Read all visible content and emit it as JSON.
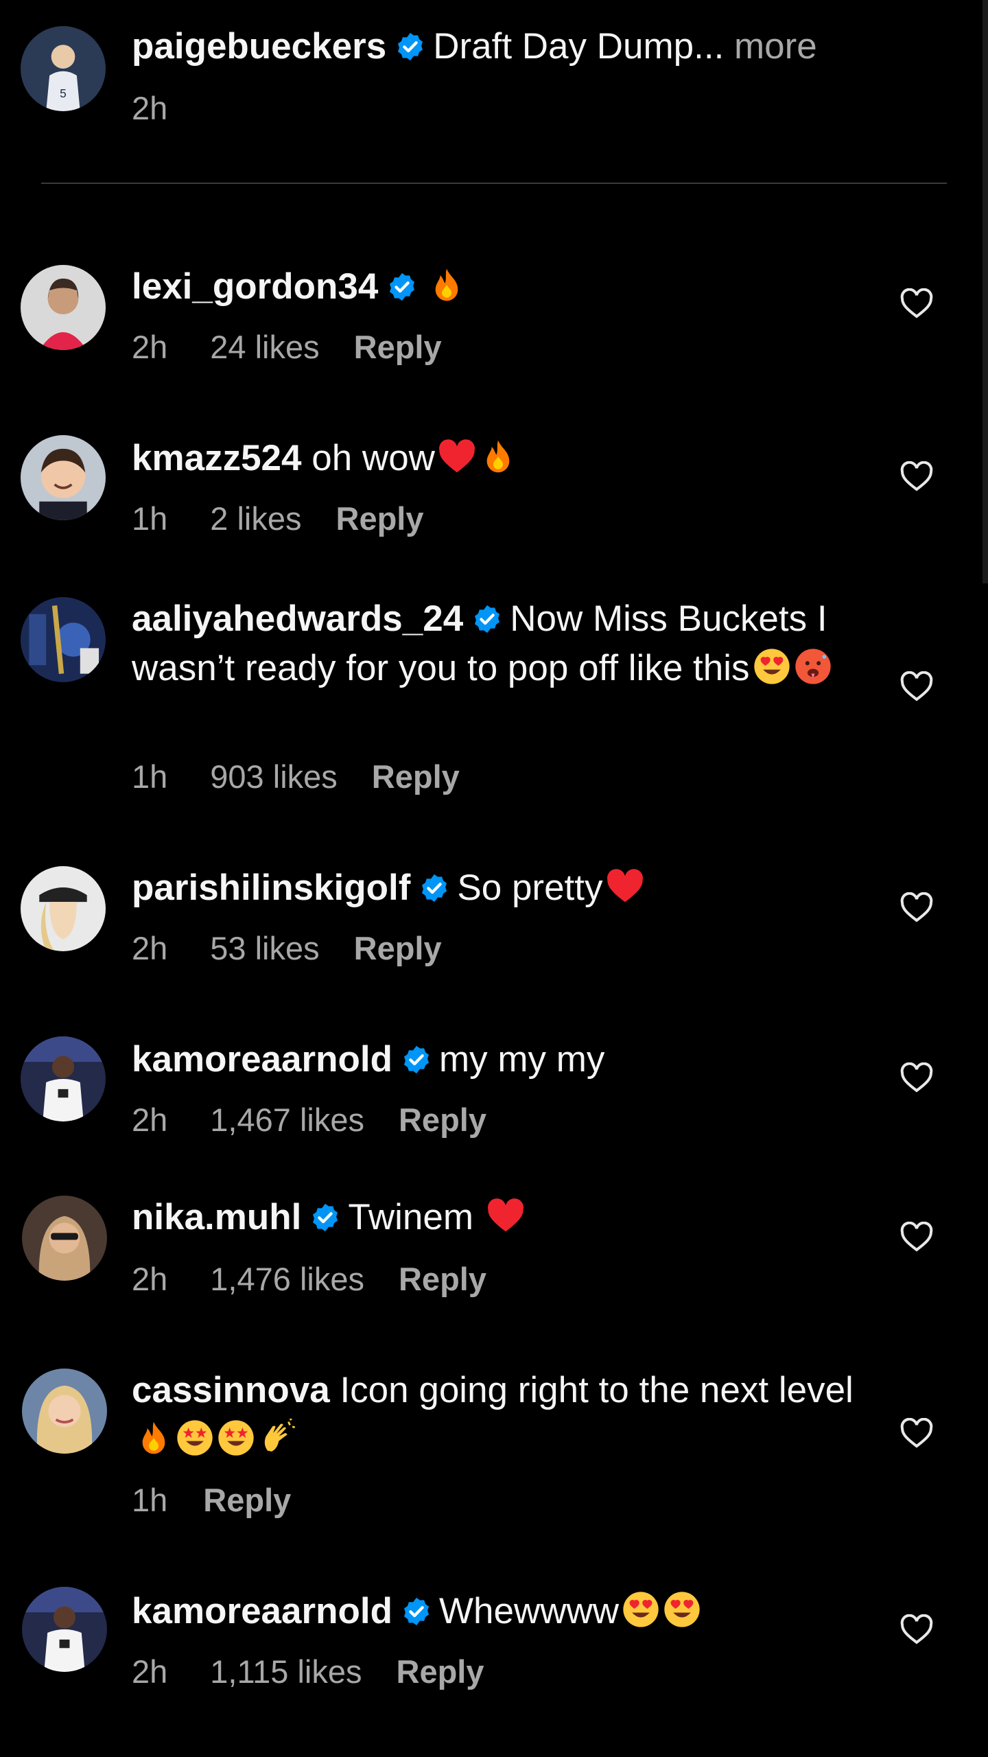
{
  "colors": {
    "background": "#000000",
    "text": "#f5f5f5",
    "secondary": "#a8a8a8",
    "verified": "#0095f6"
  },
  "caption": {
    "username": "paigebueckers",
    "verified": true,
    "text": "Draft Day Dump...",
    "more_label": "more",
    "time": "2h"
  },
  "comments": [
    {
      "username": "lexi_gordon34",
      "verified": true,
      "text": "",
      "emojis": [
        "fire"
      ],
      "time": "2h",
      "likes": "24 likes",
      "reply_label": "Reply"
    },
    {
      "username": "kmazz524",
      "verified": false,
      "text": "oh wow",
      "emojis": [
        "red-heart",
        "fire"
      ],
      "time": "1h",
      "likes": "2 likes",
      "reply_label": "Reply"
    },
    {
      "username": "aaliyahedwards_24",
      "verified": true,
      "text": "Now Miss Buckets I wasn’t ready for you to pop off like this",
      "emojis": [
        "heart-eyes",
        "hot-face"
      ],
      "time": "1h",
      "likes": "903 likes",
      "reply_label": "Reply"
    },
    {
      "username": "parishilinskigolf",
      "verified": true,
      "text": "So pretty",
      "emojis": [
        "red-heart"
      ],
      "time": "2h",
      "likes": "53 likes",
      "reply_label": "Reply"
    },
    {
      "username": "kamoreaarnold",
      "verified": true,
      "text": "my my my",
      "emojis": [],
      "time": "2h",
      "likes": "1,467 likes",
      "reply_label": "Reply"
    },
    {
      "username": "nika.muhl",
      "verified": true,
      "text": "Twinem",
      "emojis": [
        "red-heart"
      ],
      "time": "2h",
      "likes": "1,476 likes",
      "reply_label": "Reply"
    },
    {
      "username": "cassinnova",
      "verified": false,
      "text": "Icon going right to the next level",
      "emojis": [
        "fire",
        "star-struck",
        "star-struck",
        "clapping-hands"
      ],
      "time": "1h",
      "likes": "",
      "reply_label": "Reply"
    },
    {
      "username": "kamoreaarnold",
      "verified": true,
      "text": "Whewwww",
      "emojis": [
        "heart-eyes",
        "heart-eyes"
      ],
      "time": "2h",
      "likes": "1,115 likes",
      "reply_label": "Reply"
    }
  ]
}
